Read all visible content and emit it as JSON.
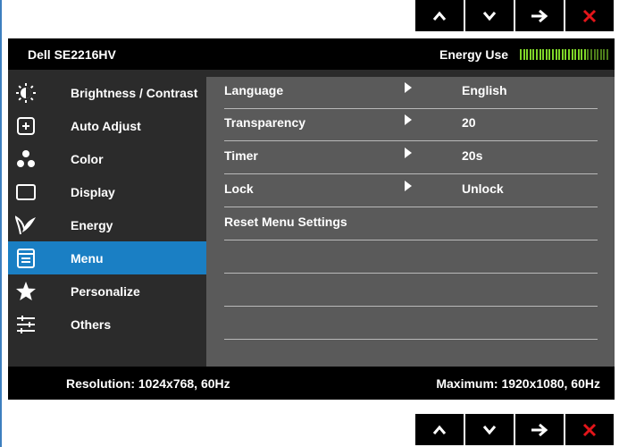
{
  "nav_buttons": [
    {
      "name": "up-button",
      "icon": "chevron-up-icon"
    },
    {
      "name": "down-button",
      "icon": "chevron-down-icon"
    },
    {
      "name": "enter-button",
      "icon": "arrow-right-icon"
    },
    {
      "name": "exit-button",
      "icon": "close-icon"
    }
  ],
  "colors": {
    "accent": "#1a7fc4",
    "close": "#e3151a",
    "energy_on": "#7fd628",
    "energy_off": "#4d7d1a"
  },
  "title_bar": {
    "model": "Dell SE2216HV",
    "energy_label": "Energy Use",
    "energy_level": 0.75
  },
  "sidebar": {
    "items": [
      {
        "label": "Brightness / Contrast",
        "icon": "brightness-icon",
        "active": false
      },
      {
        "label": "Auto Adjust",
        "icon": "auto-adjust-icon",
        "active": false
      },
      {
        "label": "Color",
        "icon": "color-icon",
        "active": false
      },
      {
        "label": "Display",
        "icon": "display-icon",
        "active": false
      },
      {
        "label": "Energy",
        "icon": "energy-leaf-icon",
        "active": false
      },
      {
        "label": "Menu",
        "icon": "menu-icon",
        "active": true
      },
      {
        "label": "Personalize",
        "icon": "star-icon",
        "active": false
      },
      {
        "label": "Others",
        "icon": "sliders-icon",
        "active": false
      }
    ]
  },
  "menu_rows": [
    {
      "label": "Language",
      "value": "English",
      "has_arrow": true
    },
    {
      "label": "Transparency",
      "value": "20",
      "has_arrow": true
    },
    {
      "label": "Timer",
      "value": "20s",
      "has_arrow": true
    },
    {
      "label": "Lock",
      "value": "Unlock",
      "has_arrow": true
    },
    {
      "label": "Reset Menu Settings",
      "value": "",
      "has_arrow": false
    },
    {
      "label": "",
      "value": "",
      "has_arrow": false
    },
    {
      "label": "",
      "value": "",
      "has_arrow": false
    },
    {
      "label": "",
      "value": "",
      "has_arrow": false
    }
  ],
  "footer": {
    "resolution": "Resolution: 1024x768, 60Hz",
    "maximum": "Maximum: 1920x1080, 60Hz"
  }
}
